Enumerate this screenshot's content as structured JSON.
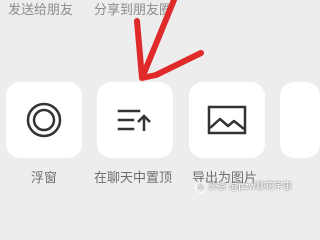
{
  "top_row": {
    "send_to_friend": "发送给朋友",
    "share_to_moments": "分享到朋友圈"
  },
  "actions": [
    {
      "label": "浮窗",
      "icon": "floating-window-icon"
    },
    {
      "label": "在聊天中置顶",
      "icon": "pin-to-top-icon"
    },
    {
      "label": "导出为图片",
      "icon": "image-icon"
    }
  ],
  "watermark": {
    "text": "头条 @pzw聊花宇宙",
    "logo": "toutiao-logo"
  },
  "colors": {
    "background": "#ededed",
    "card": "#ffffff",
    "icon": "#333333",
    "annotation": "#e02a2a"
  }
}
